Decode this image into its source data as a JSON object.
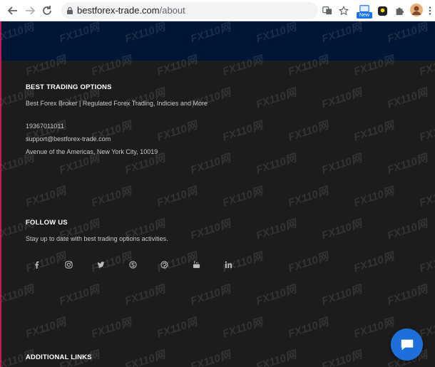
{
  "browser": {
    "url_domain": "bestforex-trade.com",
    "url_path": "/about",
    "new_badge": "New",
    "watermark": "FX110网"
  },
  "footer": {
    "trading": {
      "heading": "BEST TRADING OPTIONS",
      "tagline": "Best Forex Broker | Regulated Forex Trading, Indicies and More",
      "phone": "19367011011",
      "email": "support@bestforex-trade.com",
      "address": "Avenue of the Americas, New York City, 10019"
    },
    "follow": {
      "heading": "FOLLOW US",
      "text": "Stay up to date with best trading options activities.",
      "icons": [
        "facebook-icon",
        "instagram-icon",
        "twitter-icon",
        "skype-icon",
        "pinterest-icon",
        "youtube-icon",
        "linkedin-icon"
      ]
    },
    "links": {
      "heading": "ADDITIONAL LINKS"
    }
  },
  "colors": {
    "hero": "#001635",
    "footer": "#1c1c1c",
    "chat": "#1e6fd9",
    "icon": "#bdbdbd"
  }
}
